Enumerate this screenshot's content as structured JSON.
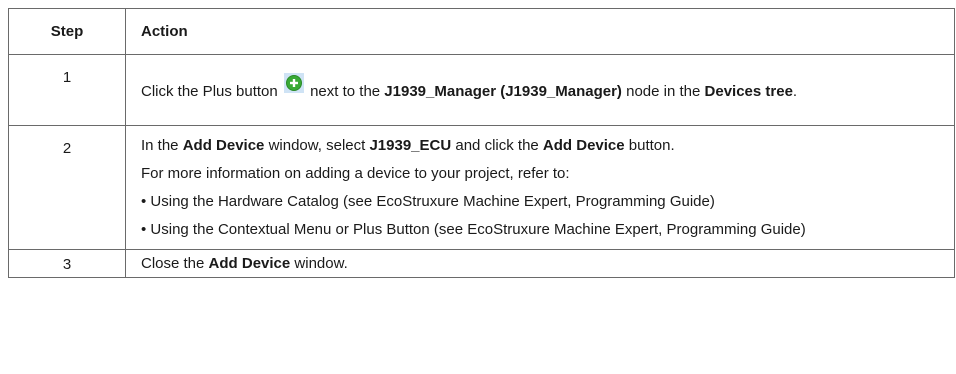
{
  "header": {
    "step": "Step",
    "action": "Action"
  },
  "row1": {
    "step": "1",
    "t1": "Click the Plus button ",
    "t2": " next to the ",
    "b1": "J1939_Manager (J1939_Manager)",
    "t3": " node in the ",
    "b2": "Devices tree",
    "t4": ".",
    "icon": "plus-circle-icon"
  },
  "row2": {
    "step": "2",
    "p1": {
      "t1": "In the ",
      "b1": "Add Device",
      "t2": " window, select ",
      "b2": "J1939_ECU",
      "t3": " and click the ",
      "b3": "Add Device",
      "t4": " button."
    },
    "p2": "For more information on adding a device to your project, refer to:",
    "p3": "• Using the Hardware Catalog (see EcoStruxure Machine Expert, Programming Guide)",
    "p4": "• Using the Contextual Menu or Plus Button (see EcoStruxure Machine Expert, Programming Guide)"
  },
  "row3": {
    "step": "3",
    "t1": "Close the ",
    "b1": "Add Device",
    "t2": " window."
  },
  "colors": {
    "border": "#6a6a6a",
    "icon_green": "#3aaa35",
    "icon_bg": "#cfe3f5"
  }
}
